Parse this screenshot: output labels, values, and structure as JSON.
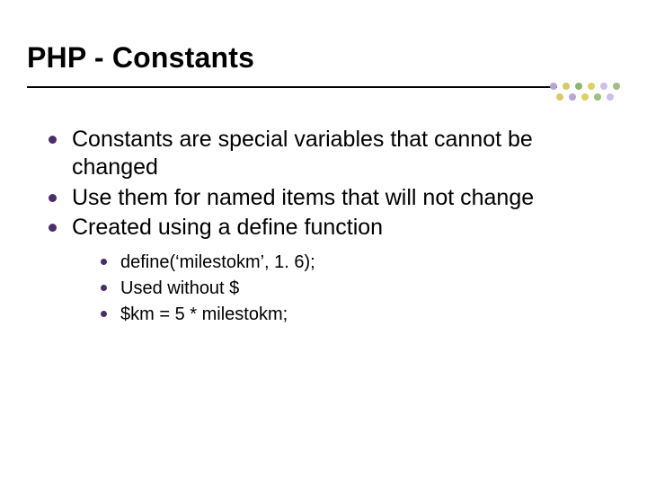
{
  "title": "PHP - Constants",
  "bullets": [
    {
      "text": "Constants are special variables that cannot be changed"
    },
    {
      "text": "Use them for named items that will not change"
    },
    {
      "text": "Created using a define function",
      "sub": [
        "define(‘milestokm’, 1. 6);",
        "Used without $",
        "$km = 5 * milestokm;"
      ]
    }
  ],
  "accent_color": "#4a2d6b"
}
